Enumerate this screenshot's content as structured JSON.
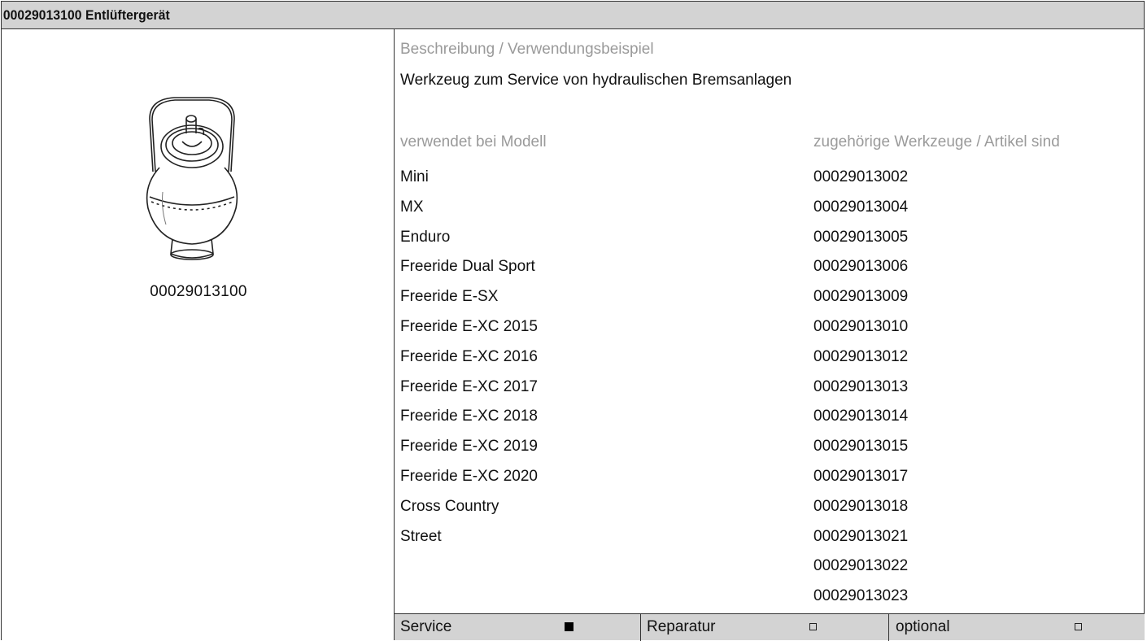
{
  "header": {
    "title": "00029013100 Entlüftergerät"
  },
  "image": {
    "icon": "bleeder-device-icon",
    "caption": "00029013100"
  },
  "description": {
    "label": "Beschreibung / Verwendungsbeispiel",
    "text": "Werkzeug zum Service von hydraulischen Bremsanlagen"
  },
  "models": {
    "label": "verwendet bei Modell",
    "items": [
      "Mini",
      "MX",
      "Enduro",
      "Freeride Dual Sport",
      "Freeride E-SX",
      "Freeride E-XC 2015",
      "Freeride E-XC 2016",
      "Freeride E-XC 2017",
      "Freeride E-XC 2018",
      "Freeride E-XC 2019",
      "Freeride E-XC 2020",
      "Cross Country",
      "Street"
    ]
  },
  "tools": {
    "label": "zugehörige Werkzeuge / Artikel sind",
    "items": [
      "00029013002",
      "00029013004",
      "00029013005",
      "00029013006",
      "00029013009",
      "00029013010",
      "00029013012",
      "00029013013",
      "00029013014",
      "00029013015",
      "00029013017",
      "00029013018",
      "00029013021",
      "00029013022",
      "00029013023"
    ]
  },
  "footer": {
    "service": {
      "label": "Service",
      "checked": true
    },
    "repair": {
      "label": "Reparatur",
      "checked": false
    },
    "optional": {
      "label": "optional",
      "checked": false
    }
  },
  "colors": {
    "header_bg": "#d3d3d3",
    "label_grey": "#9a9a9a",
    "border": "#333333"
  }
}
